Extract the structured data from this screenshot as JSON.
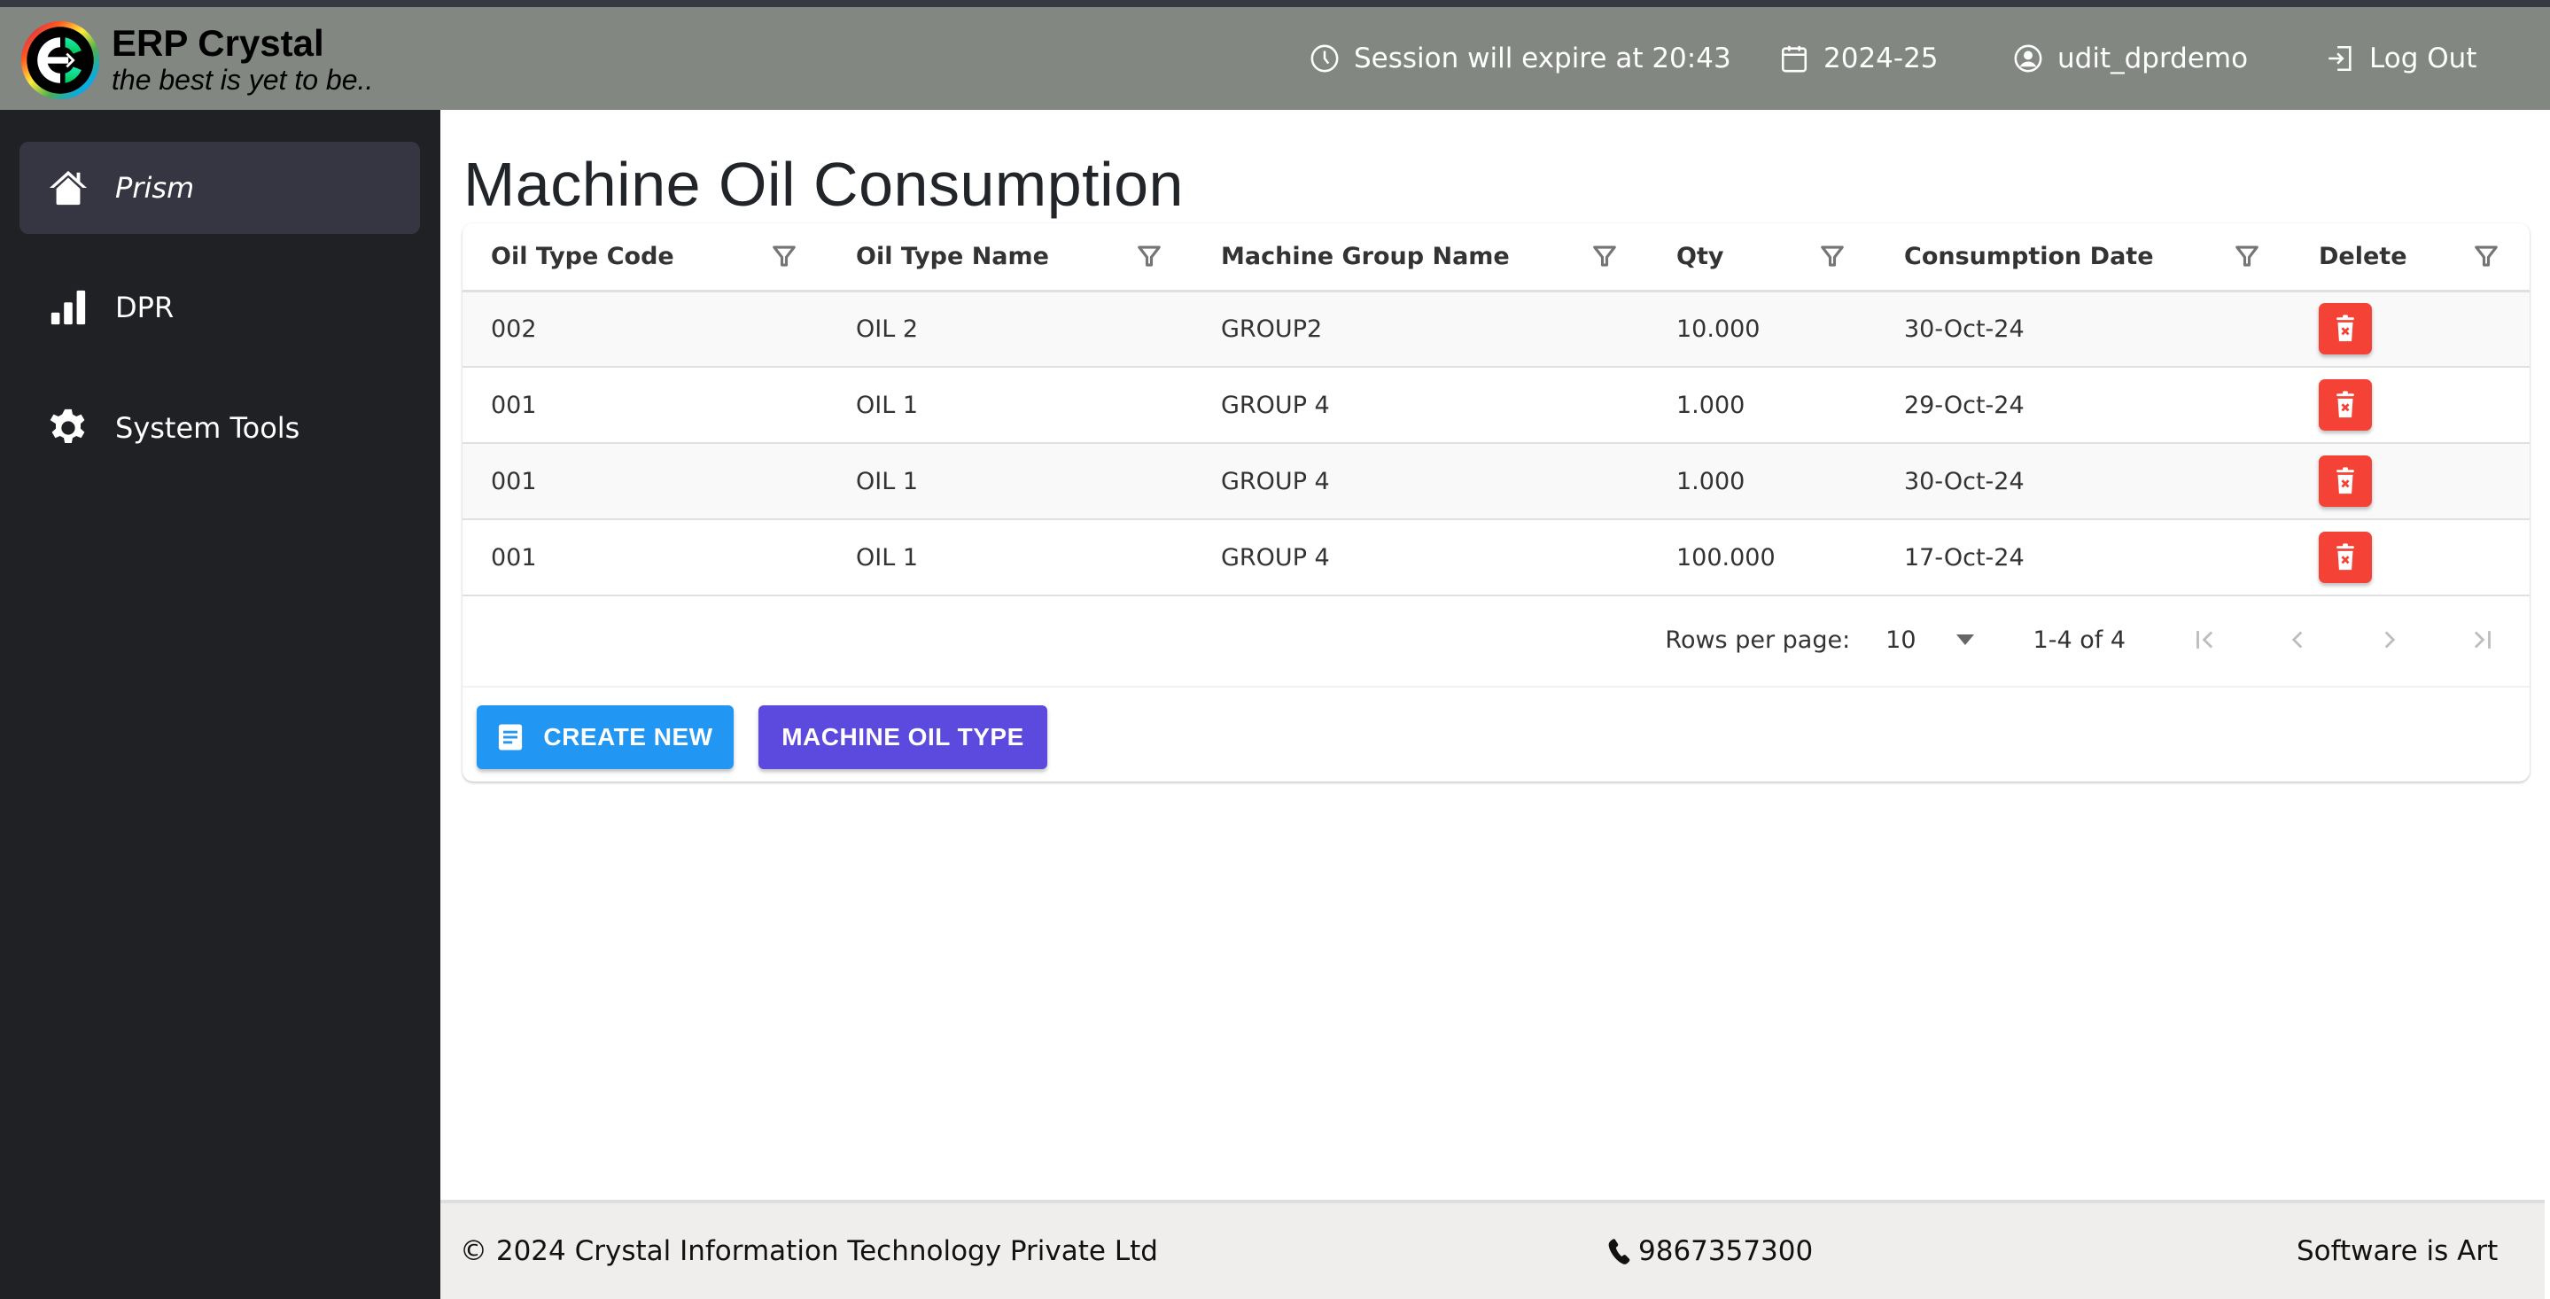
{
  "header": {
    "brand_title": "ERP Crystal",
    "brand_tagline": "the best is yet to be..",
    "session_text": "Session will expire at 20:43",
    "financial_year": "2024-25",
    "username": "udit_dprdemo",
    "logout_label": "Log Out"
  },
  "sidebar": {
    "items": [
      {
        "label": "Prism",
        "icon": "home-icon",
        "active": true
      },
      {
        "label": "DPR",
        "icon": "bar-chart-icon",
        "active": false
      },
      {
        "label": "System Tools",
        "icon": "gear-icon",
        "active": false
      }
    ]
  },
  "page": {
    "title": "Machine Oil Consumption"
  },
  "table": {
    "columns": [
      "Oil Type Code",
      "Oil Type Name",
      "Machine Group Name",
      "Qty",
      "Consumption Date",
      "Delete"
    ],
    "rows": [
      {
        "oil_type_code": "002",
        "oil_type_name": "OIL 2",
        "machine_group_name": "GROUP2",
        "qty": "10.000",
        "consumption_date": "30-Oct-24"
      },
      {
        "oil_type_code": "001",
        "oil_type_name": "OIL 1",
        "machine_group_name": "GROUP 4",
        "qty": "1.000",
        "consumption_date": "29-Oct-24"
      },
      {
        "oil_type_code": "001",
        "oil_type_name": "OIL 1",
        "machine_group_name": "GROUP 4",
        "qty": "1.000",
        "consumption_date": "30-Oct-24"
      },
      {
        "oil_type_code": "001",
        "oil_type_name": "OIL 1",
        "machine_group_name": "GROUP 4",
        "qty": "100.000",
        "consumption_date": "17-Oct-24"
      }
    ]
  },
  "pagination": {
    "rows_per_page_label": "Rows per page:",
    "rows_per_page_value": "10",
    "range_text": "1-4 of 4"
  },
  "actions": {
    "create_new_label": "CREATE NEW",
    "machine_oil_type_label": "MACHINE OIL TYPE"
  },
  "footer": {
    "copyright": "© 2024 Crystal Information Technology Private Ltd",
    "phone": "9867357300",
    "tagline": "Software is Art"
  },
  "colors": {
    "header_bg": "#828782",
    "sidebar_bg": "#202124",
    "sidebar_active_bg": "#363542",
    "delete_red": "#f44336",
    "create_blue": "#2196f3",
    "oil_type_purple": "#5c4adf",
    "footer_bg": "#efeeec"
  }
}
